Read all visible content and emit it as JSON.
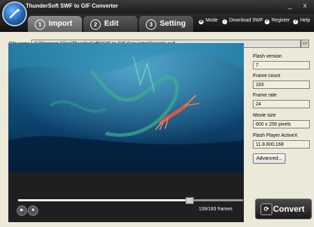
{
  "window": {
    "title": "ThunderSoft SWF to GIF Converter",
    "controls": {
      "minimize": "_",
      "close": "x"
    }
  },
  "tabs": [
    {
      "number": "1",
      "label": "Import",
      "active": true
    },
    {
      "number": "2",
      "label": "Edit",
      "active": false
    },
    {
      "number": "3",
      "label": "Setting",
      "active": false
    }
  ],
  "menu": [
    {
      "icon": "mode-icon",
      "label": "Mode"
    },
    {
      "icon": "download-icon",
      "label": "Download SWF"
    },
    {
      "icon": "register-icon",
      "label": "Register"
    },
    {
      "icon": "help-icon",
      "label": "Help"
    }
  ],
  "file": {
    "label": "File name",
    "value": "C:\\Program Files\\ThunderSoft\\SWF to GIF Converter\\Sample.swf"
  },
  "info": {
    "flash_version_label": "Flash version",
    "flash_version": "7",
    "frame_count_label": "Frame count",
    "frame_count": "183",
    "frame_rate_label": "Frame rate",
    "frame_rate": "24",
    "movie_size_label": "Movie size",
    "movie_size": "600 x 256 pixels",
    "player_label": "Flash Player ActiveX",
    "player_version": "11.8.800.168"
  },
  "advanced_label": "Advanced...",
  "player": {
    "frames_text": "139/183 frames",
    "progress": 0.76
  },
  "convert_label": "Convert",
  "colors": {
    "accent": "#1a5fb0",
    "dark": "#1f1f1f"
  }
}
